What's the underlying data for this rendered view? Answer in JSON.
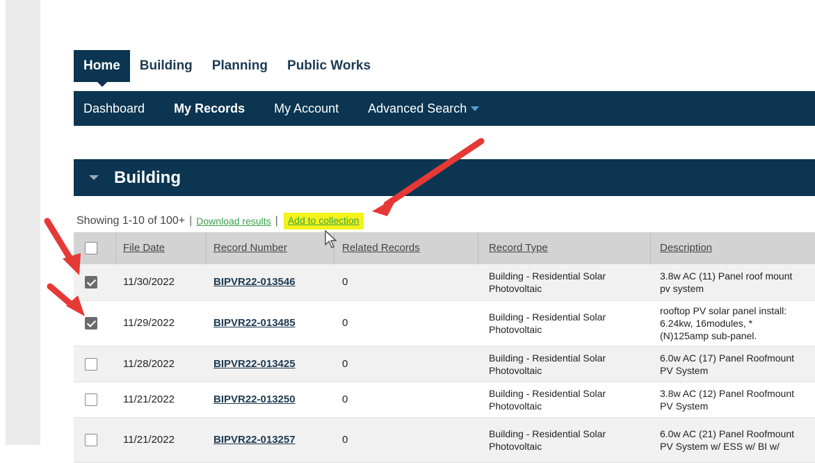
{
  "top_tabs": [
    "Home",
    "Building",
    "Planning",
    "Public Works"
  ],
  "nav": {
    "items": [
      "Dashboard",
      "My Records",
      "My Account",
      "Advanced Search"
    ]
  },
  "section": {
    "title": "Building"
  },
  "results": {
    "showing": "Showing 1-10 of 100+",
    "separator": "|",
    "download_label": "Download results",
    "add_label": "Add to collection"
  },
  "table": {
    "headers": [
      "File Date",
      "Record Number",
      "Related Records",
      "Record Type",
      "Description"
    ],
    "rows": [
      {
        "checked": true,
        "date": "11/30/2022",
        "record": "BIPVR22-013546",
        "related": "0",
        "type": "Building - Residential Solar\nPhotovoltaic",
        "desc": "3.8w AC (11) Panel roof mount\npv system"
      },
      {
        "checked": true,
        "date": "11/29/2022",
        "record": "BIPVR22-013485",
        "related": "0",
        "type": "Building - Residential Solar\nPhotovoltaic",
        "desc": "rooftop PV solar panel install:\n6.24kw, 16modules, *\n(N)125amp sub-panel."
      },
      {
        "checked": false,
        "date": "11/28/2022",
        "record": "BIPVR22-013425",
        "related": "0",
        "type": "Building - Residential Solar\nPhotovoltaic",
        "desc": "6.0w AC (17) Panel Roofmount\nPV System"
      },
      {
        "checked": false,
        "date": "11/21/2022",
        "record": "BIPVR22-013250",
        "related": "0",
        "type": "Building - Residential Solar\nPhotovoltaic",
        "desc": "3.8w AC (12) Panel Roofmount\nPV System"
      },
      {
        "checked": false,
        "date": "11/21/2022",
        "record": "BIPVR22-013257",
        "related": "0",
        "type": "Building - Residential Solar\nPhotovoltaic",
        "desc": "6.0w AC (21) Panel Roofmount\nPV System w/ ESS w/ BI w/"
      }
    ]
  },
  "colors": {
    "navy": "#0b3550",
    "link_green": "#3aa14a",
    "highlight": "#f4f31a",
    "arrow": "#e53935"
  }
}
